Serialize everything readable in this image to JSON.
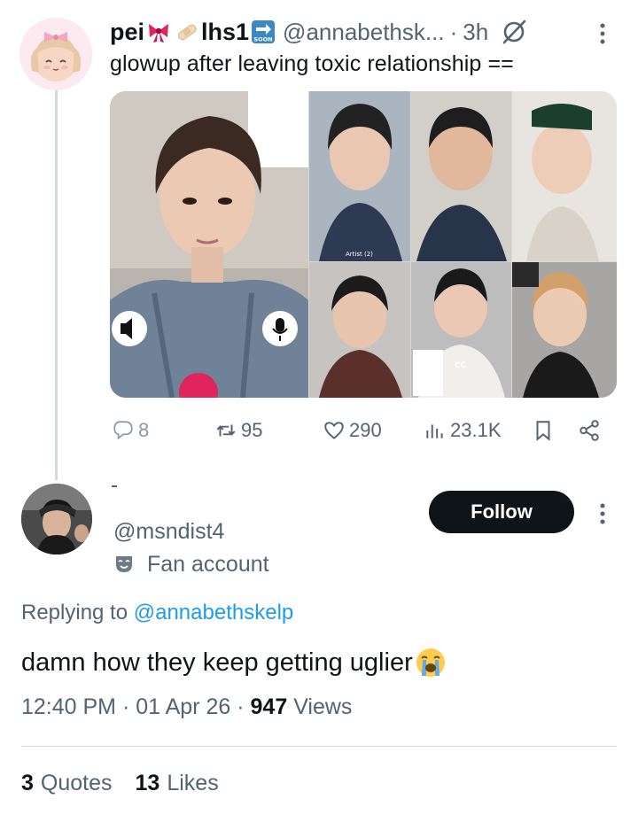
{
  "parent": {
    "display_name": "pei",
    "display_name_suffix": "lhs1",
    "handle": "@annabethsk...",
    "time": "3h",
    "text": "glowup after leaving toxic relationship ==",
    "media_labels": {
      "artist": "Artist (2)",
      "cc": "CC"
    },
    "actions": {
      "replies": "8",
      "retweets": "95",
      "likes": "290",
      "views": "23.1K"
    },
    "icons": [
      "bow-emoji",
      "soon-arrow-emoji",
      "grok-icon",
      "more-vertical-icon",
      "reply-icon",
      "retweet-icon",
      "like-icon",
      "views-icon",
      "bookmark-icon",
      "share-icon"
    ]
  },
  "reply": {
    "handle": "@msndist4",
    "label": "Fan account",
    "follow_label": "Follow",
    "replying_prefix": "Replying to ",
    "replying_to": "@annabethskelp",
    "text": "damn how they keep getting uglier",
    "time": "12:40 PM",
    "date": "01 Apr 26",
    "views_count": "947",
    "views_label": "Views",
    "quotes_count": "3",
    "quotes_label": "Quotes",
    "likes_count": "13",
    "likes_label": "Likes"
  },
  "colors": {
    "text_primary": "#0f1419",
    "text_secondary": "#536471",
    "link": "#1d9bf0",
    "follow_bg": "#0f1419",
    "divider": "#cfd9de"
  }
}
